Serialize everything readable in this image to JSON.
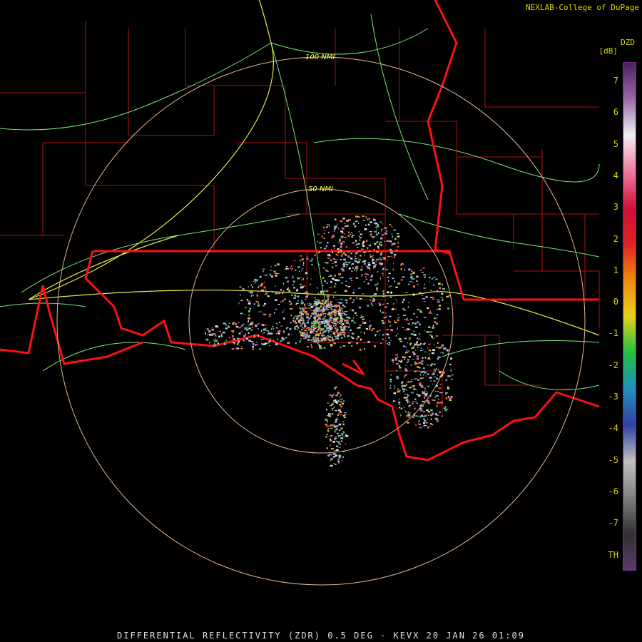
{
  "credit": "NEXLAB-College of DuPage",
  "product_code": "DZD",
  "units": "[dB]",
  "caption": "DIFFERENTIAL REFLECTIVITY (ZDR) 0.5 DEG - KEVX 20 JAN 26 01:09",
  "range_rings": [
    {
      "label": "50 NMI"
    },
    {
      "label": "100 NMI"
    }
  ],
  "colorbar": {
    "ticks": [
      "7",
      "6",
      "5",
      "4",
      "3",
      "2",
      "1",
      "0",
      "-1",
      "-2",
      "-3",
      "-4",
      "-5",
      "-6",
      "-7",
      "TH"
    ],
    "colors": [
      "#4b1f5f",
      "#9a6aa6",
      "#f0f0f0",
      "#f07aa0",
      "#d0103a",
      "#e02020",
      "#f08a10",
      "#e8d020",
      "#20c040",
      "#2090c0",
      "#3040a0",
      "#c0c0c0",
      "#808080",
      "#303030",
      "#5a3a6a"
    ]
  },
  "map_colors": {
    "state_border": "#ff1010",
    "county_border": "#b01010",
    "highway_major": "#e8e840",
    "highway_minor": "#78e878",
    "range_ring": "#e8b890",
    "ring_label": "#ffff40"
  }
}
